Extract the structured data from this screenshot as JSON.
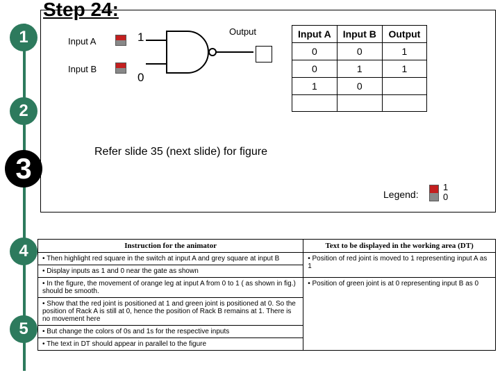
{
  "title": "Step 24:",
  "stepper": {
    "s1": "1",
    "s2": "2",
    "s3": "3",
    "s4": "4",
    "s5": "5"
  },
  "gate": {
    "inputA_label": "Input A",
    "inputB_label": "Input B",
    "valA": "1",
    "valB": "0",
    "output_label": "Output"
  },
  "truth": {
    "hA": "Input A",
    "hB": "Input B",
    "hO": "Output",
    "r0": {
      "a": "0",
      "b": "0",
      "o": "1"
    },
    "r1": {
      "a": "0",
      "b": "1",
      "o": "1"
    },
    "r2": {
      "a": "1",
      "b": "0",
      "o": ""
    },
    "r3": {
      "a": "",
      "b": "",
      "o": ""
    }
  },
  "refer": "Refer slide 35 (next slide) for figure",
  "legend": {
    "label": "Legend:",
    "hi": "1",
    "lo": "0"
  },
  "instr": {
    "hLeft": "Instruction for the animator",
    "hRight": "Text to be displayed in the working area (DT)",
    "l0": "Then highlight red square in the switch at input A and grey square at input B",
    "l1": "Display inputs as 1 and 0 near the gate as shown",
    "l2": "In the figure, the movement of orange leg at input A from 0 to 1 ( as shown in fig.) should be smooth.",
    "l3": "Show that the red joint is positioned at 1 and green joint is positioned at 0. So the position of Rack A is still at 0, hence the position of Rack B remains at 1. There is no movement here",
    "l4": "But change the colors of 0s and 1s for the respective inputs",
    "l5": "The text in DT should appear in parallel to the figure",
    "r0": "Position of  red joint is moved to 1 representing input A as 1",
    "r1": "Position of  green joint is at 0 representing input B as 0"
  },
  "chart_data": {
    "type": "table",
    "title": "NAND truth table (partial)",
    "columns": [
      "Input A",
      "Input B",
      "Output"
    ],
    "rows": [
      [
        0,
        0,
        1
      ],
      [
        0,
        1,
        1
      ],
      [
        1,
        0,
        null
      ],
      [
        null,
        null,
        null
      ]
    ]
  }
}
